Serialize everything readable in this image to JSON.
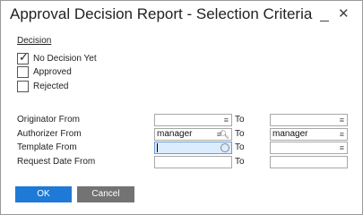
{
  "window": {
    "title": "Approval Decision Report - Selection Criteria",
    "minimize_icon": "minimize-icon",
    "close_icon": "close-icon"
  },
  "decision": {
    "label": "Decision",
    "options": [
      {
        "label": "No Decision Yet",
        "checked": true
      },
      {
        "label": "Approved",
        "checked": false
      },
      {
        "label": "Rejected",
        "checked": false
      }
    ]
  },
  "criteria": {
    "to_label": "To",
    "rows": [
      {
        "label": "Originator From",
        "from_value": "",
        "to_value": "",
        "from_icon": "list-icon",
        "to_icon": "list-icon"
      },
      {
        "label": "Authorizer From",
        "from_value": "manager",
        "to_value": "manager",
        "from_icon": "list-search-icon",
        "to_icon": "list-icon"
      },
      {
        "label": "Template From",
        "from_value": "",
        "to_value": "",
        "from_icon": "search-icon",
        "to_icon": "list-icon"
      },
      {
        "label": "Request Date From",
        "from_value": "",
        "to_value": "",
        "from_icon": "",
        "to_icon": ""
      }
    ]
  },
  "buttons": {
    "ok": "OK",
    "cancel": "Cancel"
  },
  "colors": {
    "ok_button": "#1e7ad6",
    "cancel_button": "#737373",
    "focused_field": "#dcecff"
  }
}
